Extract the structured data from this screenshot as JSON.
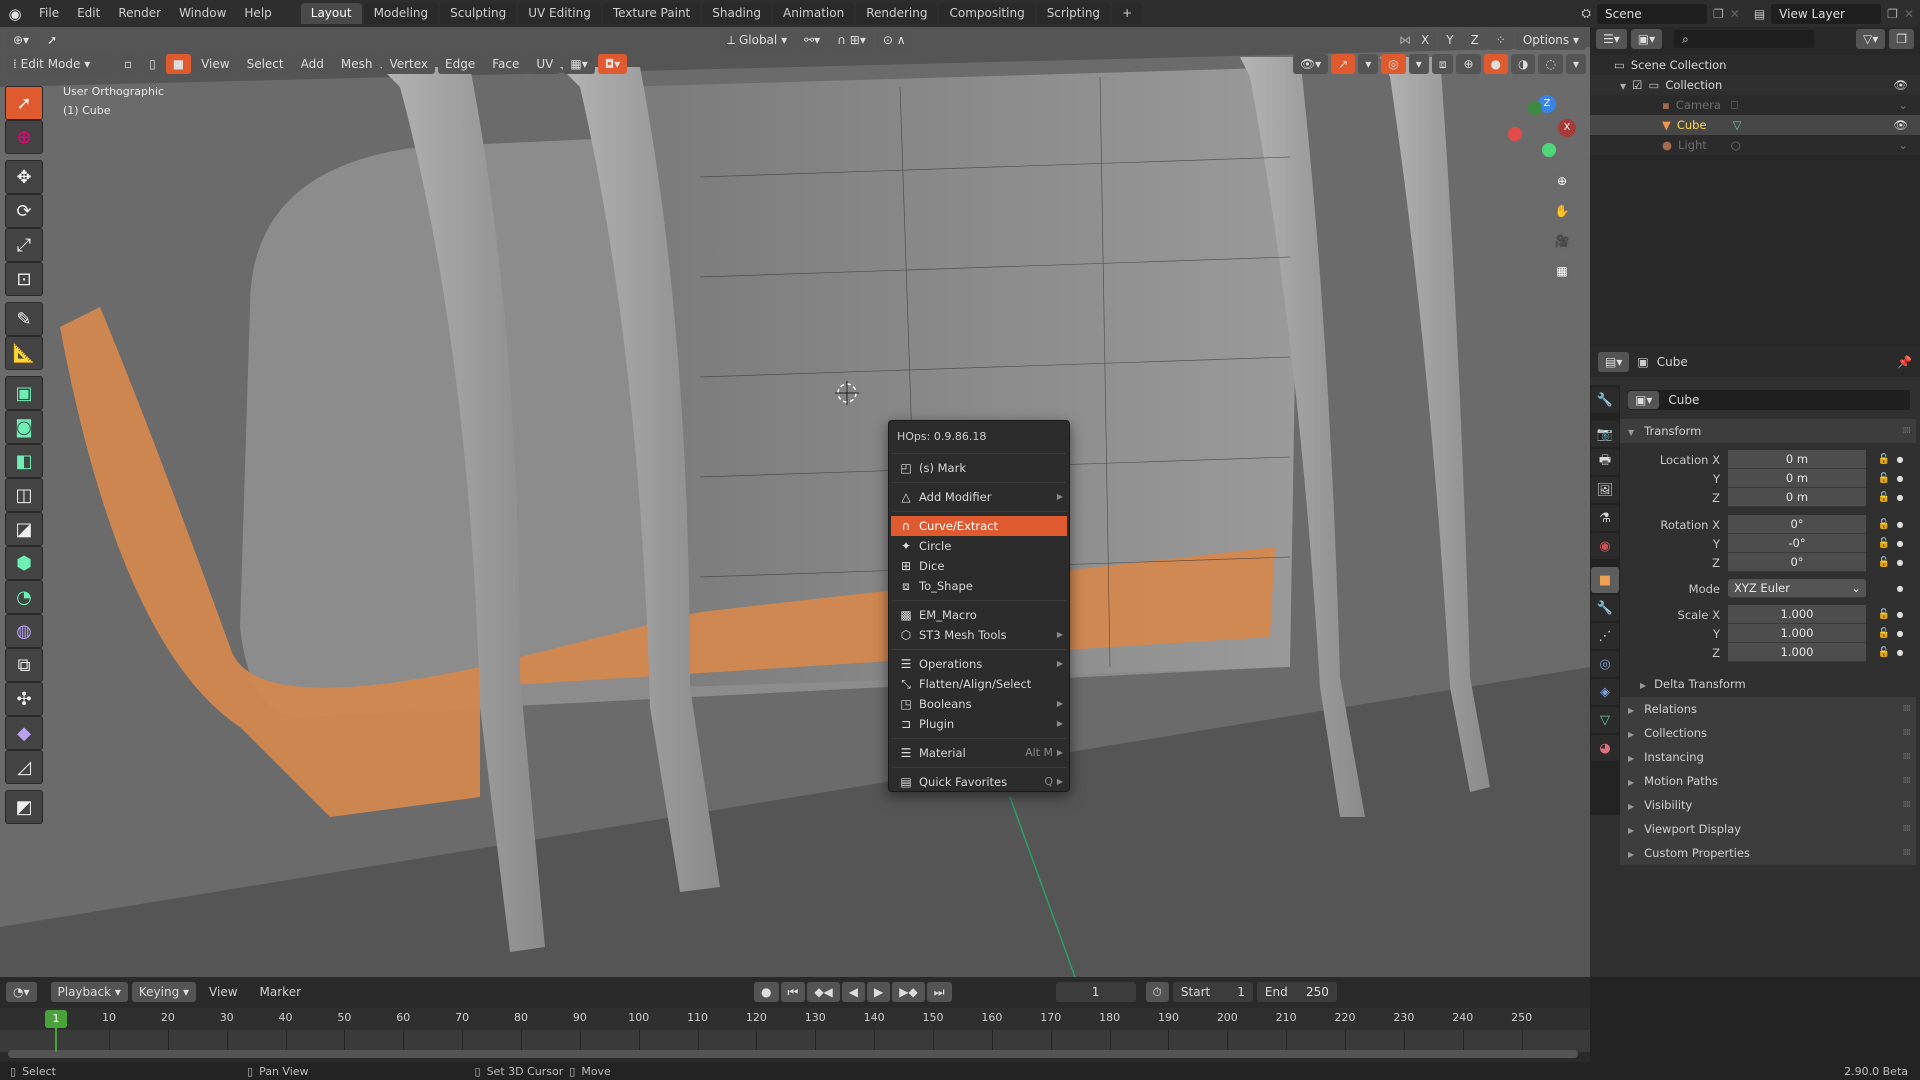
{
  "topbar": {
    "menus": [
      "File",
      "Edit",
      "Render",
      "Window",
      "Help"
    ],
    "workspaces": [
      "Layout",
      "Modeling",
      "Sculpting",
      "UV Editing",
      "Texture Paint",
      "Shading",
      "Animation",
      "Rendering",
      "Compositing",
      "Scripting"
    ],
    "active_workspace": "Layout",
    "add_workspace": "+",
    "scene": "Scene",
    "view_layer": "View Layer"
  },
  "tool_header": {
    "orientation": "Global",
    "axis_x": "X",
    "axis_y": "Y",
    "axis_z": "Z",
    "options": "Options"
  },
  "viewport_header": {
    "mode": "Edit Mode",
    "menus": [
      "View",
      "Select",
      "Add",
      "Mesh",
      "Vertex",
      "Edge",
      "Face",
      "UV"
    ]
  },
  "viewport": {
    "view_name": "User Orthographic",
    "object_name": "(1) Cube",
    "gizmo": {
      "x": "X",
      "y": "Y",
      "z": "Z"
    },
    "colors": {
      "orange_face": "#d4884f",
      "mesh": "#8c8c8c",
      "background": "#5a5a5a"
    }
  },
  "hops_menu": {
    "title": "HOps: 0.9.86.18",
    "items": [
      {
        "label": "(s) Mark",
        "icon": "mark-icon",
        "submenu": false
      },
      {
        "label": "Add Modifier",
        "icon": "modifier-icon",
        "submenu": true
      },
      {
        "label": "Curve/Extract",
        "icon": "curve-icon",
        "submenu": false,
        "highlighted": true
      },
      {
        "label": "Circle",
        "icon": "circle-icon",
        "submenu": false
      },
      {
        "label": "Dice",
        "icon": "dice-icon",
        "submenu": false
      },
      {
        "label": "To_Shape",
        "icon": "to-shape-icon",
        "submenu": false
      },
      {
        "label": "EM_Macro",
        "icon": "macro-icon",
        "submenu": false
      },
      {
        "label": "ST3 Mesh Tools",
        "icon": "mesh-tools-icon",
        "submenu": true
      },
      {
        "label": "Operations",
        "icon": "operations-icon",
        "submenu": true
      },
      {
        "label": "Flatten/Align/Select",
        "icon": "align-icon",
        "submenu": false
      },
      {
        "label": "Booleans",
        "icon": "booleans-icon",
        "submenu": true
      },
      {
        "label": "Plugin",
        "icon": "plugin-icon",
        "submenu": true
      },
      {
        "label": "Material",
        "icon": "material-icon",
        "submenu": true,
        "shortcut": "Alt M"
      },
      {
        "label": "Quick Favorites",
        "icon": "favorites-icon",
        "submenu": true,
        "shortcut": "Q"
      }
    ]
  },
  "outliner": {
    "root": "Scene Collection",
    "collection": "Collection",
    "objects": [
      {
        "name": "Camera",
        "selected": false
      },
      {
        "name": "Cube",
        "selected": true
      },
      {
        "name": "Light",
        "selected": false
      }
    ]
  },
  "properties": {
    "header_object": "Cube",
    "object_name": "Cube",
    "transform_title": "Transform",
    "location_label": "Location X",
    "rotation_label": "Rotation X",
    "scale_label": "Scale X",
    "y_label": "Y",
    "z_label": "Z",
    "location": [
      "0 m",
      "0 m",
      "0 m"
    ],
    "rotation": [
      "0°",
      "-0°",
      "0°"
    ],
    "mode_label": "Mode",
    "mode_value": "XYZ Euler",
    "scale": [
      "1.000",
      "1.000",
      "1.000"
    ],
    "delta_transform": "Delta Transform",
    "panels": [
      "Relations",
      "Collections",
      "Instancing",
      "Motion Paths",
      "Visibility",
      "Viewport Display",
      "Custom Properties"
    ]
  },
  "timeline": {
    "menus": {
      "playback": "Playback",
      "keying": "Keying",
      "view": "View",
      "marker": "Marker"
    },
    "current_frame": "1",
    "start_label": "Start",
    "start": "1",
    "end_label": "End",
    "end": "250",
    "ticks": [
      "10",
      "20",
      "30",
      "40",
      "50",
      "60",
      "70",
      "80",
      "90",
      "100",
      "110",
      "120",
      "130",
      "140",
      "150",
      "160",
      "170",
      "180",
      "190",
      "200",
      "210",
      "220",
      "230",
      "240",
      "250"
    ],
    "playhead": "1"
  },
  "statusbar": {
    "select": "Select",
    "pan_view": "Pan View",
    "set_cursor": "Set 3D Cursor",
    "move": "Move",
    "version": "2.90.0 Beta"
  }
}
